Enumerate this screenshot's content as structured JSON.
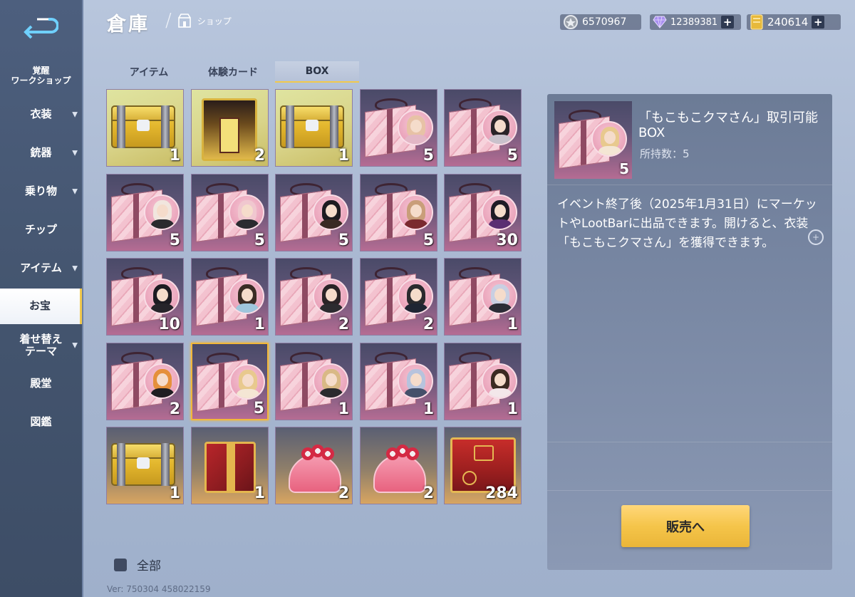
{
  "sidebar": {
    "items": [
      {
        "label": "覚醒\nワークショップ",
        "caret": false
      },
      {
        "label": "衣装",
        "caret": true
      },
      {
        "label": "銃器",
        "caret": true
      },
      {
        "label": "乗り物",
        "caret": true
      },
      {
        "label": "チップ",
        "caret": false
      },
      {
        "label": "アイテム",
        "caret": true
      },
      {
        "label": "お宝",
        "caret": false,
        "active": true
      },
      {
        "label": "着せ替え\nテーマ",
        "caret": true
      },
      {
        "label": "殿堂",
        "caret": false
      },
      {
        "label": "図鑑",
        "caret": false
      }
    ]
  },
  "header": {
    "title": "倉庫",
    "breadcrumb": "ショップ",
    "currencies": [
      {
        "icon": "silver-coin-icon",
        "value": "6570967",
        "plus": false
      },
      {
        "icon": "diamond-icon",
        "value": "12389381",
        "plus": true
      },
      {
        "icon": "gold-ticket-icon",
        "value": "240614",
        "plus": true
      }
    ]
  },
  "tabs": [
    {
      "label": "アイテム",
      "active": false
    },
    {
      "label": "体験カード",
      "active": false
    },
    {
      "label": "BOX",
      "active": true
    }
  ],
  "grid": {
    "items": [
      {
        "kind": "gold-chest",
        "count": "1"
      },
      {
        "kind": "gold-crate",
        "count": "2"
      },
      {
        "kind": "gold-chest",
        "count": "1"
      },
      {
        "kind": "gift",
        "count": "5",
        "hair": "#e7c2a6",
        "outfit": "#e3b7c6"
      },
      {
        "kind": "gift",
        "count": "5",
        "hair": "#2a2428",
        "outfit": "#c9c2cc"
      },
      {
        "kind": "gift",
        "count": "5",
        "hair": "#f1e6de",
        "outfit": "#2a2a2e"
      },
      {
        "kind": "gift",
        "count": "5",
        "hair": "#f0c7cf",
        "outfit": "#2b2b30"
      },
      {
        "kind": "gift",
        "count": "5",
        "hair": "#1d1b20",
        "outfit": "#3a2a24"
      },
      {
        "kind": "gift",
        "count": "5",
        "hair": "#c99e7a",
        "outfit": "#7a2a2f"
      },
      {
        "kind": "gift",
        "count": "30",
        "hair": "#1f1b25",
        "outfit": "#5a2f72"
      },
      {
        "kind": "gift",
        "count": "10",
        "hair": "#1d1b22",
        "outfit": "#26242a"
      },
      {
        "kind": "gift",
        "count": "1",
        "hair": "#3a2c24",
        "outfit": "#9fc6dc"
      },
      {
        "kind": "gift",
        "count": "2",
        "hair": "#2a2326",
        "outfit": "#2b2b2f"
      },
      {
        "kind": "gift",
        "count": "2",
        "hair": "#2a2a2e",
        "outfit": "#1f2533"
      },
      {
        "kind": "gift",
        "count": "1",
        "hair": "#c9cfe2",
        "outfit": "#2b2c36"
      },
      {
        "kind": "gift",
        "count": "2",
        "hair": "#e5903b",
        "outfit": "#1f1e22"
      },
      {
        "kind": "gift",
        "count": "5",
        "hair": "#e8c98e",
        "outfit": "#f4e6d4",
        "selected": true
      },
      {
        "kind": "gift",
        "count": "1",
        "hair": "#d9b986",
        "outfit": "#2a2a2e"
      },
      {
        "kind": "gift",
        "count": "1",
        "hair": "#b7c3dd",
        "outfit": "#44506a"
      },
      {
        "kind": "gift",
        "count": "1",
        "hair": "#3b2a22",
        "outfit": "#f3e7ea"
      },
      {
        "kind": "gold-chest-orange",
        "count": "1"
      },
      {
        "kind": "red-gold-box",
        "count": "1"
      },
      {
        "kind": "heart-box",
        "count": "2"
      },
      {
        "kind": "heart-box",
        "count": "2"
      },
      {
        "kind": "big-red-box",
        "count": "284"
      }
    ]
  },
  "detail": {
    "name": "「もこもこクマさん」取引可能BOX",
    "owned": "所持数：5",
    "thumb_count": "5",
    "description": "イベント終了後（2025年1月31日）にマーケットやLootBarに出品できます。開けると、衣装「もこもこクマさん」を獲得できます。",
    "sell_label": "販売へ"
  },
  "footer": {
    "all_label": "全部",
    "version": "Ver: 750304 458022159"
  },
  "colors": {
    "accent": "#f2c94c",
    "sidebar_bg": "#44556f",
    "panel_bg": "#7584a0",
    "sell_button": "#f5c54a"
  }
}
